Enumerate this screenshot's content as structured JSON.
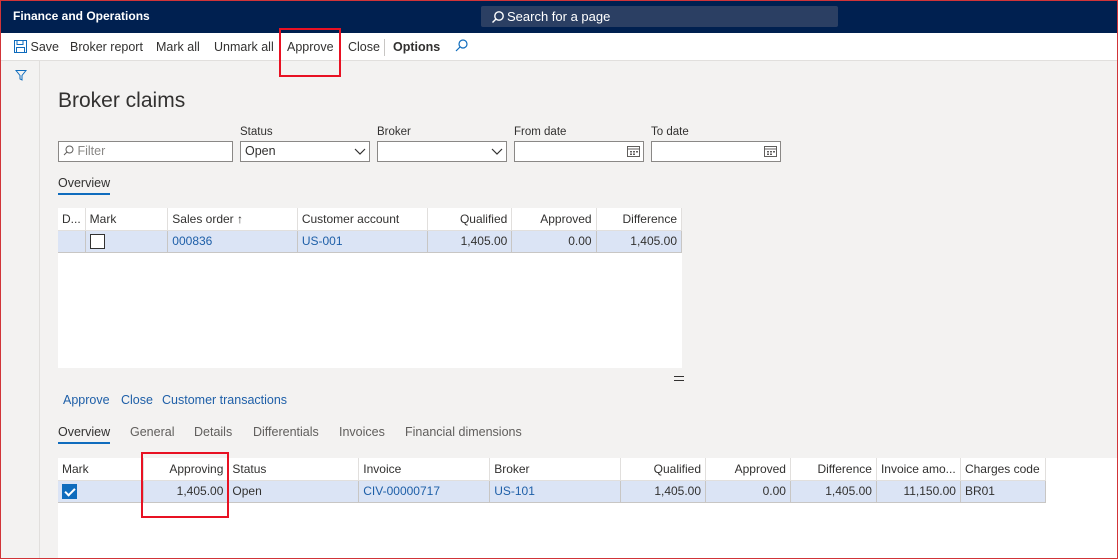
{
  "app": {
    "title": "Finance and Operations"
  },
  "search": {
    "label": "Search for a page"
  },
  "toolbar": {
    "save": "Save",
    "broker_report": "Broker report",
    "mark_all": "Mark all",
    "unmark_all": "Unmark all",
    "approve": "Approve",
    "close": "Close",
    "options": "Options"
  },
  "page": {
    "title": "Broker claims"
  },
  "filters": {
    "filter_placeholder": "Filter",
    "status_label": "Status",
    "status_value": "Open",
    "broker_label": "Broker",
    "broker_value": "",
    "from_date_label": "From date",
    "to_date_label": "To date"
  },
  "top_tab": "Overview",
  "claims_grid": {
    "headers": [
      "D...",
      "Mark",
      "Sales order",
      "Customer account",
      "Qualified",
      "Approved",
      "Difference"
    ],
    "rows": [
      {
        "mark": false,
        "sales_order": "000836",
        "customer_account": "US-001",
        "qualified": "1,405.00",
        "approved": "0.00",
        "difference": "1,405.00"
      }
    ]
  },
  "lines_actions": {
    "approve": "Approve",
    "close": "Close",
    "customer_transactions": "Customer transactions"
  },
  "lines_tabs": [
    "Overview",
    "General",
    "Details",
    "Differentials",
    "Invoices",
    "Financial dimensions"
  ],
  "lines_grid": {
    "headers": [
      "Mark",
      "Approving",
      "Status",
      "Invoice",
      "Broker",
      "Qualified",
      "Approved",
      "Difference",
      "Invoice amo...",
      "Charges code"
    ],
    "rows": [
      {
        "mark": true,
        "approving": "1,405.00",
        "status": "Open",
        "invoice": "CIV-00000717",
        "broker": "US-101",
        "qualified": "1,405.00",
        "approved": "0.00",
        "difference": "1,405.00",
        "invoice_amount": "11,150.00",
        "charges_code": "BR01"
      }
    ]
  },
  "colors": {
    "nav": "#002050",
    "accent": "#0f6cbd",
    "highlight": "#e81123"
  }
}
